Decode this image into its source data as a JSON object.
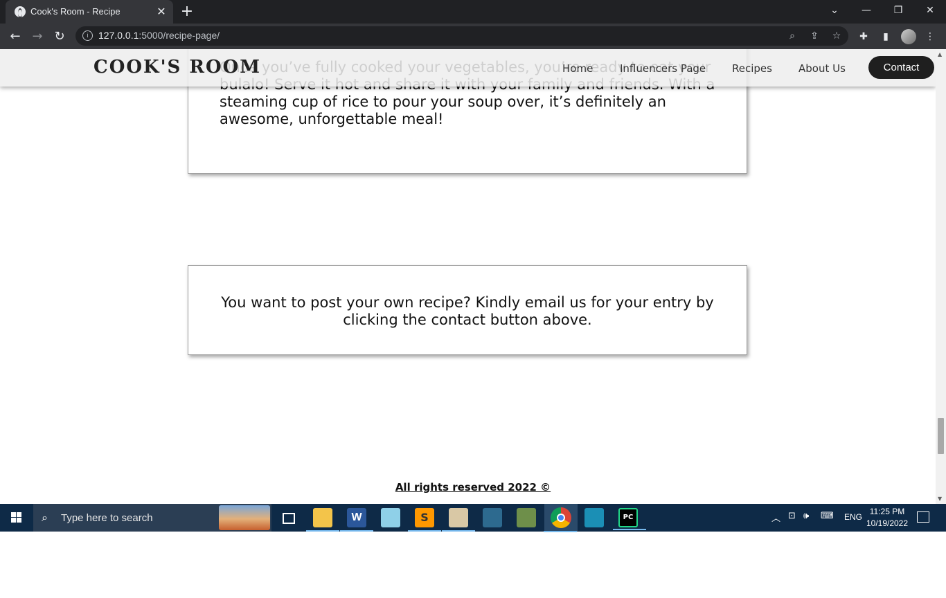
{
  "browser": {
    "tab_title": "Cook's Room - Recipe",
    "tab_close": "✕",
    "new_tab": "+",
    "url_host": "127.0.0.1",
    "url_rest": ":5000/recipe-page/",
    "window_controls": {
      "tab_search": "⌄",
      "minimize": "—",
      "restore": "❐",
      "close": "✕"
    },
    "nav": {
      "back": "←",
      "forward": "→",
      "reload": "↻"
    },
    "omnibox_icons": {
      "info": "i",
      "zoom": "⌕",
      "share": "⇪",
      "star": "☆"
    },
    "toolbar_icons": {
      "extensions": "✚",
      "side_panel": "▮",
      "menu": "⋮"
    }
  },
  "page": {
    "brand": "COOK'S ROOM",
    "nav": {
      "home": "Home",
      "influencers": "Influencers Page",
      "recipes": "Recipes",
      "about": "About Us",
      "contact": "Contact"
    },
    "card1_text": "Once you’ve fully cooked your vegetables, you’re ready to eat your bulalo! Serve it hot and share it with your family and friends. With a steaming cup of rice to pour your soup over, it’s definitely an awesome, unforgettable meal!",
    "card2_text": "You want to post your own recipe? Kindly email us for your entry by clicking the contact button above.",
    "footer": "All rights reserved 2022 ©",
    "scroll_position": 0.9
  },
  "taskbar": {
    "search_placeholder": "Type here to search",
    "search_icon": "⌕",
    "word_letter": "W",
    "sublime_letter": "S",
    "pycharm_letters": "PC",
    "tray": {
      "up_arrow": "︿",
      "network": "⊡",
      "volume": "🕪",
      "keyboard": "⌨"
    },
    "language": "ENG",
    "time": "11:25 PM",
    "date": "10/19/2022"
  }
}
